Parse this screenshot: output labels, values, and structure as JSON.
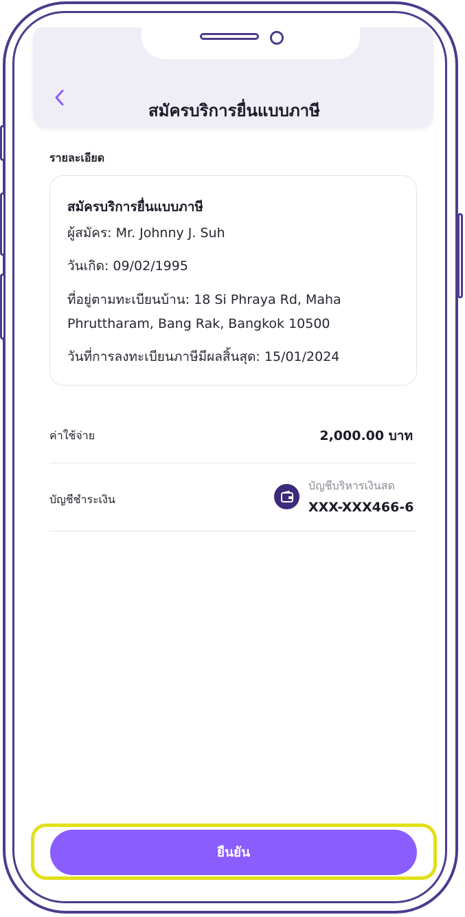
{
  "header": {
    "title": "สมัครบริการยื่นแบบภาษี",
    "back_icon": "chevron-left-icon"
  },
  "details": {
    "section_label": "รายละเอียด",
    "card_title": "สมัครบริการยื่นแบบภาษี",
    "applicant": "ผู้สมัคร: Mr. Johnny J. Suh",
    "birthdate": "วันเกิด: 09/02/1995",
    "address_line1": "ที่อยู่ตามทะเบียนบ้าน: 18 Si Phraya Rd, Maha",
    "address_line2": "Phruttharam, Bang Rak, Bangkok 10500",
    "expiry": "วันที่การลงทะเบียนภาษีมีผลสิ้นสุด: 15/01/2024"
  },
  "payment": {
    "fee_label": "ค่าใช้จ่าย",
    "fee_amount": "2,000.00 บาท",
    "account_label": "บัญชีชำระเงิน",
    "account_name": "บัญชีบริหารเงินสด",
    "account_number": "XXX-XXX466-6",
    "account_icon": "wallet-icon"
  },
  "actions": {
    "confirm_label": "ยืนยัน"
  },
  "colors": {
    "accent": "#8a5dff",
    "frame": "#4d3b8c",
    "highlight": "#e2e01a",
    "header_bg": "#efeef6"
  }
}
